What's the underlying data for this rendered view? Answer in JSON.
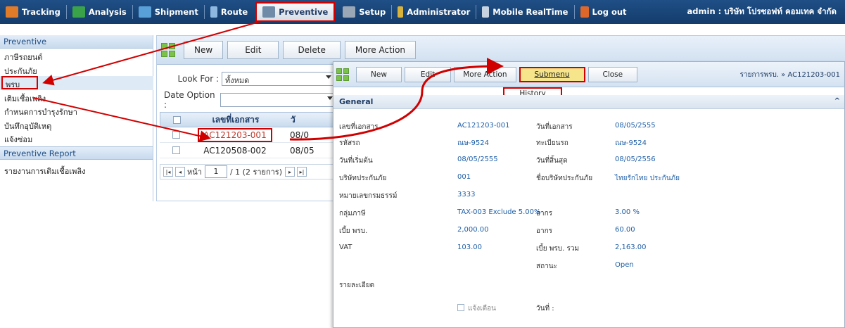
{
  "topnav": {
    "items": [
      {
        "label": "Tracking",
        "icon": "tracking-icon",
        "color": "#e07b2a"
      },
      {
        "label": "Analysis",
        "icon": "analysis-icon",
        "color": "#3aa34a"
      },
      {
        "label": "Shipment",
        "icon": "shipment-icon",
        "color": "#5aa0d8"
      },
      {
        "label": "Route",
        "icon": "route-icon",
        "color": "#8fb8e0"
      },
      {
        "label": "Preventive",
        "icon": "preventive-icon",
        "color": "#6f8ba8"
      },
      {
        "label": "Setup",
        "icon": "setup-icon",
        "color": "#9aa7b6"
      },
      {
        "label": "Administrator",
        "icon": "administrator-icon",
        "color": "#d9b23c"
      },
      {
        "label": "Mobile RealTime",
        "icon": "mobile-icon",
        "color": "#c7d3e0"
      },
      {
        "label": "Log out",
        "icon": "logout-icon",
        "color": "#e0672a"
      }
    ],
    "user": "admin : บริษัท โปรซอฟท์ คอมเทค จำกัด"
  },
  "sidebar": {
    "section1": "Preventive",
    "items": [
      "ภาษีรถยนต์",
      "ประกันภัย",
      "พรบ",
      "เติมเชื้อเพลิง",
      "กำหนดการบำรุงรักษา",
      "บันทึกอุบัติเหตุ",
      "แจ้งซ่อม"
    ],
    "section2": "Preventive Report",
    "report_items": [
      "รายงานการเติมเชื้อเพลิง"
    ]
  },
  "toolbar": {
    "new": "New",
    "edit": "Edit",
    "delete": "Delete",
    "more": "More Action"
  },
  "filters": {
    "look_for_label": "Look For :",
    "look_for_value": "ทั้งหมด",
    "date_option_label": "Date Option :",
    "date_option_value": ""
  },
  "table": {
    "header_doc": "เลขที่เอกสาร",
    "header_date": "วั",
    "rows": [
      {
        "doc": "AC121203-001",
        "date": "08/0"
      },
      {
        "doc": "AC120508-002",
        "date": "08/05"
      }
    ]
  },
  "pager": {
    "page_label": "หน้า",
    "page": "1",
    "total": "/ 1 (2 รายการ)"
  },
  "popup": {
    "new": "New",
    "edit": "Edit",
    "more": "More Action",
    "submenu": "Submenu",
    "close": "Close",
    "history": "History",
    "breadcrumb": "รายการพรบ. » AC121203-001",
    "section": "General",
    "fields": {
      "doc_no_label": "เลขที่เอกสาร",
      "doc_no": "AC121203-001",
      "doc_date_label": "วันที่เอกสาร",
      "doc_date": "08/05/2555",
      "car_code_label": "รหัสรถ",
      "car_code": "ณษ-9524",
      "plate_label": "ทะเบียนรถ",
      "plate": "ณษ-9524",
      "start_label": "วันที่เริ่มต้น",
      "start": "08/05/2555",
      "end_label": "วันที่สิ้นสุด",
      "end": "08/05/2556",
      "insurer_label": "บริษัทประกันภัย",
      "insurer": "001",
      "insurer_name_label": "ชื่อบริษัทประกันภัย",
      "insurer_name": "ไทยรักไทย ประกันภัย",
      "policy_label": "หมายเลขกรมธรรม์",
      "policy": "3333",
      "tax_group_label": "กลุ่มภาษี",
      "tax_group": "TAX-003 Exclude 5.00%",
      "duty_label": "อากร",
      "duty_pct": "3.00 %",
      "premium_label": "เบี้ย พรบ.",
      "premium": "2,000.00",
      "duty2_label": "อากร",
      "duty_amt": "60.00",
      "vat_label": "VAT",
      "vat": "103.00",
      "total_label": "เบี้ย พรบ. รวม",
      "total": "2,163.00",
      "status_label": "สถานะ",
      "status": "Open",
      "detail_label": "รายละเอียด",
      "remind_label": "แจ้งเตือน",
      "date_label": "วันที่ :"
    }
  },
  "colors": {
    "highlight": "#d10000",
    "nav_bg": "#1f4f86",
    "link": "#1f5fa8"
  }
}
